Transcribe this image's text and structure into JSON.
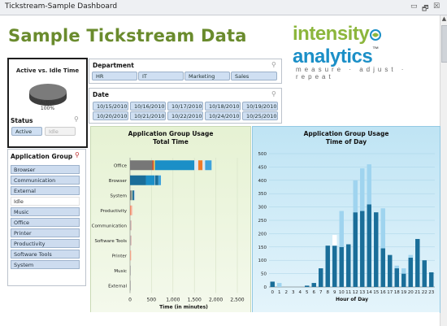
{
  "window": {
    "title": "Tickstream-Sample Dashboard",
    "min_glyph": "▭",
    "restore_glyph": "🗗",
    "close_glyph": "☒",
    "scroll_up_glyph": "▲"
  },
  "page_title": "Sample Tickstream Data",
  "logo": {
    "part1": "intensity",
    "part2": "analytics",
    "tm": "™",
    "tagline": "measure · adjust · repeat"
  },
  "pie": {
    "title": "Active vs. Idle Time",
    "label_name": "Active",
    "label_pct": "100%",
    "colors": {
      "top": "#7b7b7b",
      "side": "#3d3d3d"
    }
  },
  "status": {
    "title": "Status",
    "active": "Active",
    "idle": "Idle"
  },
  "department": {
    "title": "Department",
    "items": [
      "HR",
      "IT",
      "Marketing",
      "Sales"
    ]
  },
  "date": {
    "title": "Date",
    "items": [
      "10/15/2010",
      "10/16/2010",
      "10/17/2010",
      "10/18/2010",
      "10/19/2010",
      "10/20/2010",
      "10/21/2010",
      "10/22/2010",
      "10/24/2010",
      "10/25/2010"
    ]
  },
  "app_group": {
    "title": "Application Group",
    "items": [
      {
        "label": "Browser",
        "selected": true
      },
      {
        "label": "Communication",
        "selected": true
      },
      {
        "label": "External",
        "selected": true
      },
      {
        "label": "Idle",
        "selected": false
      },
      {
        "label": "Music",
        "selected": true
      },
      {
        "label": "Office",
        "selected": true
      },
      {
        "label": "Printer",
        "selected": true
      },
      {
        "label": "Productivity",
        "selected": true
      },
      {
        "label": "Software Tools",
        "selected": true
      },
      {
        "label": "System",
        "selected": true
      }
    ]
  },
  "colors": {
    "title_green": "#6a8b2d",
    "selected_fill": "#cddcef",
    "bar_dark": "#1a6e99",
    "bar_light": "#9fd4ef"
  },
  "chart_data": [
    {
      "type": "bar",
      "orientation": "horizontal",
      "stacked": true,
      "title": "Application Group Usage",
      "subtitle": "Total Time",
      "xlabel": "Time (in minutes)",
      "xlim": [
        0,
        2500
      ],
      "xticks": [
        "0",
        "500",
        "1,000",
        "1,500",
        "2,000",
        "2,500"
      ],
      "categories": [
        "Office",
        "Browser",
        "System",
        "Productivity",
        "Communication",
        "Software Tools",
        "Printer",
        "Music",
        "External"
      ],
      "segments": [
        {
          "category": "Office",
          "parts": [
            {
              "value": 520,
              "color": "#777777"
            },
            {
              "value": 30,
              "color": "#d24b2a"
            },
            {
              "value": 30,
              "color": "#f4c24a"
            },
            {
              "value": 920,
              "color": "#1b8fc7"
            },
            {
              "value": 90,
              "color": "#dfe8f2"
            },
            {
              "value": 100,
              "color": "#f07a2a"
            },
            {
              "value": 60,
              "color": "#dfe8f2"
            },
            {
              "value": 150,
              "color": "#3ea2dc"
            }
          ]
        },
        {
          "category": "Browser",
          "parts": [
            {
              "value": 370,
              "color": "#1a6e99"
            },
            {
              "value": 200,
              "color": "#1b8fc7"
            },
            {
              "value": 10,
              "color": "#dfe8f2"
            },
            {
              "value": 80,
              "color": "#1a6e99"
            },
            {
              "value": 60,
              "color": "#3ea2dc"
            }
          ]
        },
        {
          "category": "System",
          "parts": [
            {
              "value": 30,
              "color": "#777777"
            },
            {
              "value": 30,
              "color": "#9fb2a0"
            },
            {
              "value": 40,
              "color": "#1a6e99"
            },
            {
              "value": 20,
              "color": "#dfe8f2"
            }
          ]
        },
        {
          "category": "Productivity",
          "parts": [
            {
              "value": 30,
              "color": "#f08c6a"
            },
            {
              "value": 30,
              "color": "#f7c9b8"
            }
          ]
        },
        {
          "category": "Communication",
          "parts": [
            {
              "value": 15,
              "color": "#a0a0a0"
            },
            {
              "value": 10,
              "color": "#d8a0a0"
            }
          ]
        },
        {
          "category": "Software Tools",
          "parts": [
            {
              "value": 15,
              "color": "#a0a0a0"
            },
            {
              "value": 10,
              "color": "#d8a0a0"
            }
          ]
        },
        {
          "category": "Printer",
          "parts": [
            {
              "value": 15,
              "color": "#f08c6a"
            },
            {
              "value": 15,
              "color": "#f7c9b8"
            }
          ]
        },
        {
          "category": "Music",
          "parts": [
            {
              "value": 8,
              "color": "#a0a0a0"
            }
          ]
        },
        {
          "category": "External",
          "parts": [
            {
              "value": 8,
              "color": "#a0a0a0"
            }
          ]
        }
      ]
    },
    {
      "type": "bar",
      "stacked": true,
      "title": "Application Group Usage",
      "subtitle": "Time of Day",
      "xlabel": "Hour of Day",
      "ylim": [
        0,
        500
      ],
      "yticks": [
        "0",
        "50",
        "100",
        "150",
        "200",
        "250",
        "300",
        "350",
        "400",
        "450",
        "500"
      ],
      "categories": [
        "0",
        "1",
        "2",
        "3",
        "4",
        "5",
        "6",
        "7",
        "8",
        "9",
        "10",
        "11",
        "12",
        "13",
        "14",
        "15",
        "16",
        "17",
        "18",
        "19",
        "20",
        "21",
        "22",
        "23"
      ],
      "series": [
        {
          "color": "#1a6e99",
          "values": [
            20,
            0,
            0,
            0,
            0,
            5,
            15,
            70,
            155,
            155,
            150,
            160,
            280,
            285,
            310,
            280,
            145,
            120,
            70,
            50,
            110,
            180,
            100,
            55
          ]
        },
        {
          "color": "#9fd4ef",
          "values": [
            0,
            15,
            0,
            0,
            0,
            0,
            0,
            0,
            0,
            0,
            135,
            0,
            120,
            160,
            150,
            0,
            150,
            0,
            10,
            20,
            10,
            0,
            0,
            0
          ]
        },
        {
          "color": "#ffffff",
          "values": [
            0,
            0,
            0,
            0,
            0,
            0,
            0,
            0,
            0,
            40,
            0,
            0,
            0,
            0,
            0,
            0,
            0,
            0,
            0,
            0,
            0,
            0,
            0,
            0
          ]
        }
      ]
    }
  ]
}
